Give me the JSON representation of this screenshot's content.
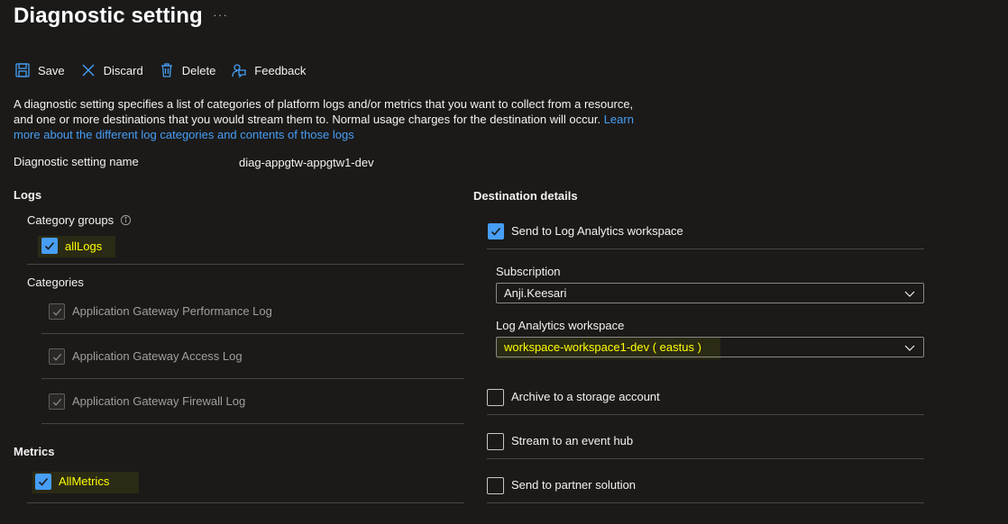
{
  "page": {
    "title": "Diagnostic setting",
    "more": "···"
  },
  "toolbar": {
    "save": "Save",
    "discard": "Discard",
    "delete": "Delete",
    "feedback": "Feedback"
  },
  "description": {
    "text": "A diagnostic setting specifies a list of categories of platform logs and/or metrics that you want to collect from a resource, and one or more destinations that you would stream them to. Normal usage charges for the destination will occur.",
    "link": "Learn more about the different log categories and contents of those logs"
  },
  "setting_name": {
    "label": "Diagnostic setting name",
    "value": "diag-appgtw-appgtw1-dev"
  },
  "logs": {
    "heading": "Logs",
    "category_groups_label": "Category groups",
    "info_icon": "info-icon",
    "all_logs": {
      "label": "allLogs",
      "checked": true
    },
    "categories_label": "Categories",
    "categories": [
      {
        "label": "Application Gateway Performance Log",
        "checked": true,
        "disabled": true
      },
      {
        "label": "Application Gateway Access Log",
        "checked": true,
        "disabled": true
      },
      {
        "label": "Application Gateway Firewall Log",
        "checked": true,
        "disabled": true
      }
    ]
  },
  "metrics": {
    "heading": "Metrics",
    "all_metrics": {
      "label": "AllMetrics",
      "checked": true
    }
  },
  "destination": {
    "heading": "Destination details",
    "log_analytics": {
      "label": "Send to Log Analytics workspace",
      "checked": true
    },
    "subscription_label": "Subscription",
    "subscription_value": "Anji.Keesari",
    "workspace_label": "Log Analytics workspace",
    "workspace_value": "workspace-workspace1-dev ( eastus )",
    "storage": {
      "label": "Archive to a storage account",
      "checked": false
    },
    "event_hub": {
      "label": "Stream to an event hub",
      "checked": false
    },
    "partner": {
      "label": "Send to partner solution",
      "checked": false
    }
  },
  "colors": {
    "background": "#1b1a19",
    "accent": "#479ef5",
    "highlight_text": "#ffff00",
    "divider": "#484644"
  }
}
